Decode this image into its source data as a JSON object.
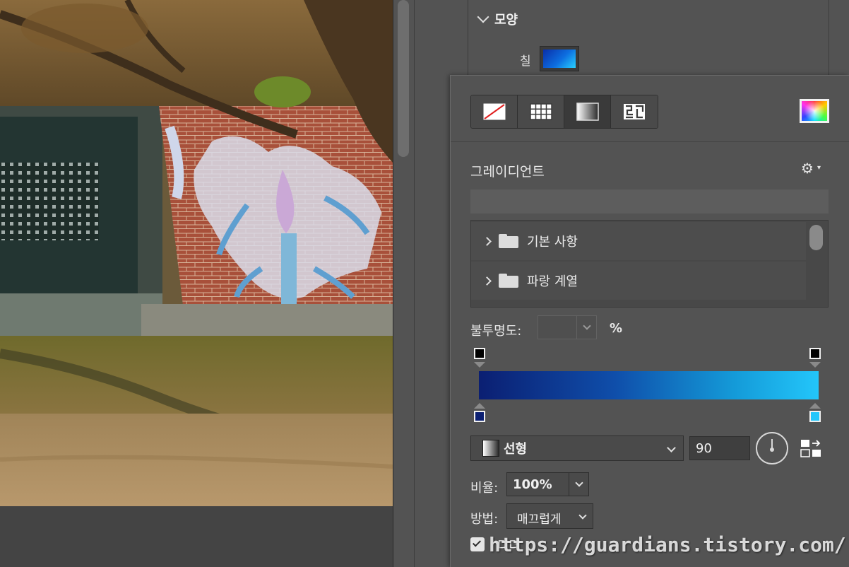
{
  "shape_section": {
    "title": "모양",
    "fill_label": "칠"
  },
  "fill_types": [
    {
      "name": "none",
      "icon": "no-fill-icon"
    },
    {
      "name": "solid",
      "icon": "swatch-grid-icon"
    },
    {
      "name": "gradient",
      "icon": "gradient-icon",
      "active": true
    },
    {
      "name": "pattern",
      "icon": "pattern-icon"
    }
  ],
  "gradient": {
    "title": "그레이디언트",
    "settings_icon": "gear-icon",
    "presets": [
      {
        "label": "기본 사항"
      },
      {
        "label": "파랑 계열"
      }
    ],
    "opacity_label": "불투명도:",
    "opacity_value": "",
    "opacity_unit": "%",
    "stops": {
      "opacity": [
        "#000000",
        "#000000"
      ],
      "color": [
        "#0b1f72",
        "#23c6fa"
      ]
    },
    "style_label": "선형",
    "angle": "90",
    "scale_label": "비율:",
    "scale_value": "100%",
    "method_label": "방법:",
    "method_value": "매끄럽게",
    "dither_label": "디더",
    "dither_checked": true
  },
  "watermark": "https://guardians.tistory.com/",
  "colors": {
    "panel": "#535353",
    "gradient_start": "#0b1f72",
    "gradient_end": "#23c6fa"
  }
}
